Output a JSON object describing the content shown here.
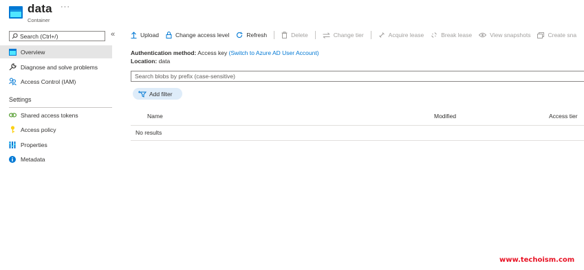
{
  "header": {
    "title": "data",
    "subtitle": "Container",
    "more": "···"
  },
  "sidebar": {
    "search_placeholder": "Search (Ctrl+/)",
    "collapse": "«",
    "items": [
      {
        "label": "Overview",
        "icon": "container-icon",
        "active": true
      },
      {
        "label": "Diagnose and solve problems",
        "icon": "wrench-icon"
      },
      {
        "label": "Access Control (IAM)",
        "icon": "people-icon"
      }
    ],
    "settings_heading": "Settings",
    "settings_items": [
      {
        "label": "Shared access tokens",
        "icon": "link-icon"
      },
      {
        "label": "Access policy",
        "icon": "key-icon"
      },
      {
        "label": "Properties",
        "icon": "bars-icon"
      },
      {
        "label": "Metadata",
        "icon": "info-icon"
      }
    ]
  },
  "toolbar": {
    "upload": "Upload",
    "change_access": "Change access level",
    "refresh": "Refresh",
    "delete": "Delete",
    "change_tier": "Change tier",
    "acquire_lease": "Acquire lease",
    "break_lease": "Break lease",
    "view_snapshots": "View snapshots",
    "create_snapshot": "Create sna"
  },
  "auth": {
    "label": "Authentication method:",
    "value": "Access key",
    "link": "(Switch to Azure AD User Account)"
  },
  "location": {
    "label": "Location:",
    "value": "data"
  },
  "blob_search_placeholder": "Search blobs by prefix (case-sensitive)",
  "add_filter": "Add filter",
  "table": {
    "columns": [
      "Name",
      "Modified",
      "Access tier"
    ],
    "empty": "No results"
  },
  "watermark": "www.techoism.com",
  "colors": {
    "accent": "#0078d4",
    "watermark": "#e81123",
    "active_item": "#e5e5e5"
  }
}
